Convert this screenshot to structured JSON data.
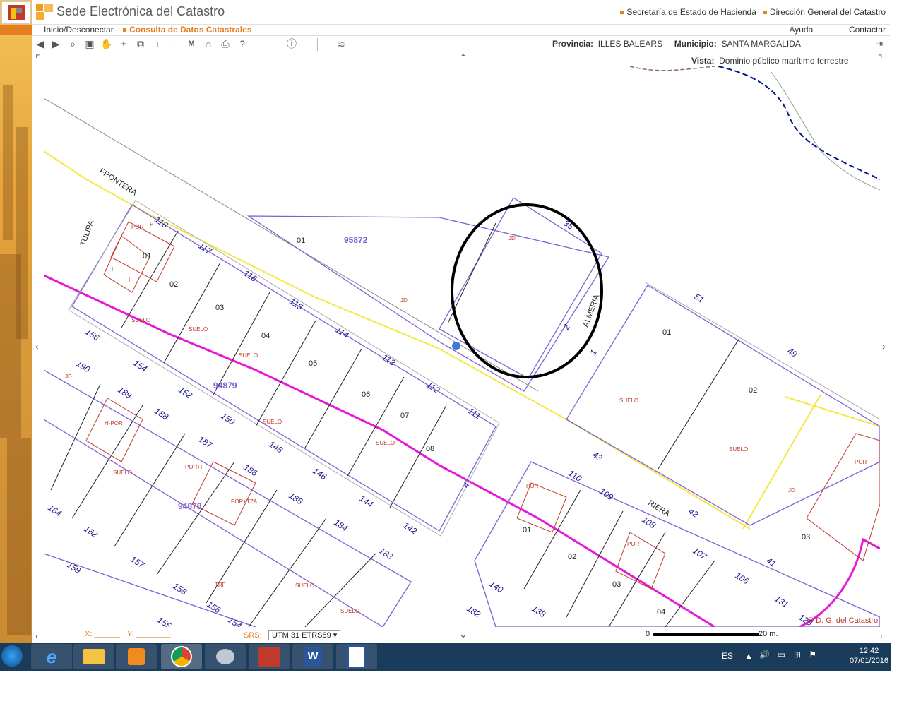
{
  "app": {
    "title": "Sede Electrónica del Catastro",
    "top_links": [
      "Secretaría de Estado de Hacienda",
      "Dirección General del Catastro"
    ]
  },
  "nav": {
    "home_link": "Inicio/Desconectar",
    "active_link": "Consulta de Datos Catastrales",
    "help_link": "Ayuda",
    "contact_link": "Contactar"
  },
  "location": {
    "provincia_label": "Provincia:",
    "provincia_value": "ILLES BALEARS",
    "municipio_label": "Municipio:",
    "municipio_value": "SANTA MARGALIDA",
    "vista_label": "Vista:",
    "vista_value": "Dominio público marítimo terrestre"
  },
  "toolbar_icons": [
    "back-icon",
    "forward-icon",
    "zoom-icon",
    "3d-icon",
    "pan-icon",
    "zoom-in-out-icon",
    "zoom-box-icon",
    "plus-icon",
    "minus-icon",
    "m-icon",
    "house-icon",
    "print-icon",
    "help-icon",
    "info-icon",
    "layers-icon"
  ],
  "map": {
    "street_labels": [
      "FRONTERA",
      "TULIPA",
      "RIERA",
      "ALMERIA"
    ],
    "parcel_ids": [
      "95872",
      "94879",
      "94878"
    ],
    "copyright": "© D. G. del Catastro",
    "plot_labels_top": [
      "01",
      "02",
      "03",
      "04",
      "05",
      "06",
      "07",
      "08"
    ],
    "right_plots": [
      "01",
      "02",
      "03"
    ],
    "numbers": [
      "118",
      "117",
      "116",
      "115",
      "114",
      "113",
      "112",
      "111",
      "156",
      "154",
      "152",
      "150",
      "148",
      "146",
      "144",
      "142",
      "190",
      "189",
      "188",
      "187",
      "186",
      "185",
      "184",
      "183",
      "164",
      "162",
      "157",
      "158",
      "156",
      "154",
      "155",
      "159",
      "51",
      "49",
      "43",
      "42",
      "41",
      "110",
      "109",
      "108",
      "107",
      "106",
      "131",
      "129",
      "140",
      "138",
      "182",
      "35",
      "2",
      "1",
      "4"
    ],
    "land_use": [
      "SUELO",
      "JD",
      "I",
      "II",
      "POR",
      "P",
      "TRF",
      "H-POR",
      "POR+TZA",
      "POR+I"
    ]
  },
  "bottom": {
    "x_label": "X:",
    "y_label": "Y:",
    "srs_label": "SRS:",
    "srs_value": "UTM 31 ETRS89",
    "scale_start": "0",
    "scale_end": "20 m."
  },
  "taskbar": {
    "language": "ES",
    "time": "12:42",
    "date": "07/01/2016"
  }
}
